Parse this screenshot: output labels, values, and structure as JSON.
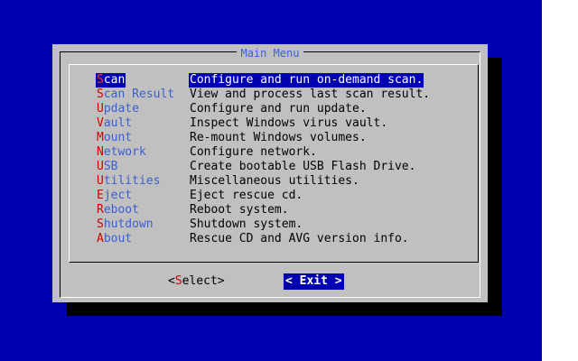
{
  "dialog": {
    "title": "Main Menu"
  },
  "menu": {
    "items": [
      {
        "hotkey": "S",
        "rest": "can",
        "description": "Configure and run on-demand scan.",
        "selected": true
      },
      {
        "hotkey": "S",
        "rest": "can Result",
        "description": "View and process last scan result."
      },
      {
        "hotkey": "U",
        "rest": "pdate",
        "description": "Configure and run update."
      },
      {
        "hotkey": "V",
        "rest": "ault",
        "description": "Inspect Windows virus vault."
      },
      {
        "hotkey": "M",
        "rest": "ount",
        "description": "Re-mount Windows volumes."
      },
      {
        "hotkey": "N",
        "rest": "etwork",
        "description": "Configure network."
      },
      {
        "hotkey": "U",
        "rest": "SB",
        "description": "Create bootable USB Flash Drive."
      },
      {
        "hotkey": "U",
        "rest": "tilities",
        "description": "Miscellaneous utilities."
      },
      {
        "hotkey": "E",
        "rest": "ject",
        "description": "Eject rescue cd."
      },
      {
        "hotkey": "R",
        "rest": "eboot",
        "description": "Reboot system."
      },
      {
        "hotkey": "S",
        "rest": "hutdown",
        "description": "Shutdown system."
      },
      {
        "hotkey": "A",
        "rest": "bout",
        "description": "Rescue CD and AVG version info."
      }
    ]
  },
  "buttons": {
    "select": {
      "open": "<",
      "hotkey": "S",
      "rest": "elect",
      "close": ">"
    },
    "exit": {
      "label": "< Exit >",
      "focused": true
    }
  },
  "colors": {
    "background": "#0000b0",
    "dialog": "#c0c0c0",
    "tag": "#3b5fcf",
    "hotkey": "#d00000",
    "selection": "#0000b0"
  }
}
